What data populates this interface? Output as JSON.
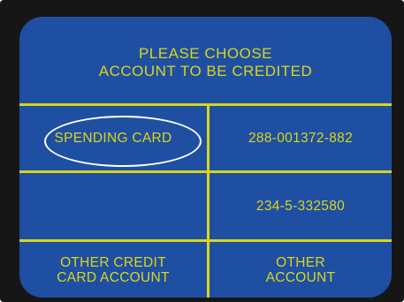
{
  "screen": {
    "title_line1": "PLEASE CHOOSE",
    "title_line2": "ACCOUNT TO BE CREDITED"
  },
  "options": {
    "spending_card": "SPENDING CARD",
    "account_1": "288-001372-882",
    "account_2": "234-5-332580",
    "other_credit_card_line1": "OTHER CREDIT",
    "other_credit_card_line2": "CARD ACCOUNT",
    "other_account_line1": "OTHER",
    "other_account_line2": "ACCOUNT"
  },
  "colors": {
    "screen_background": "#1f4fa3",
    "text_and_lines": "#d9d61a",
    "bezel": "#161616",
    "highlight": "#ffffff"
  }
}
